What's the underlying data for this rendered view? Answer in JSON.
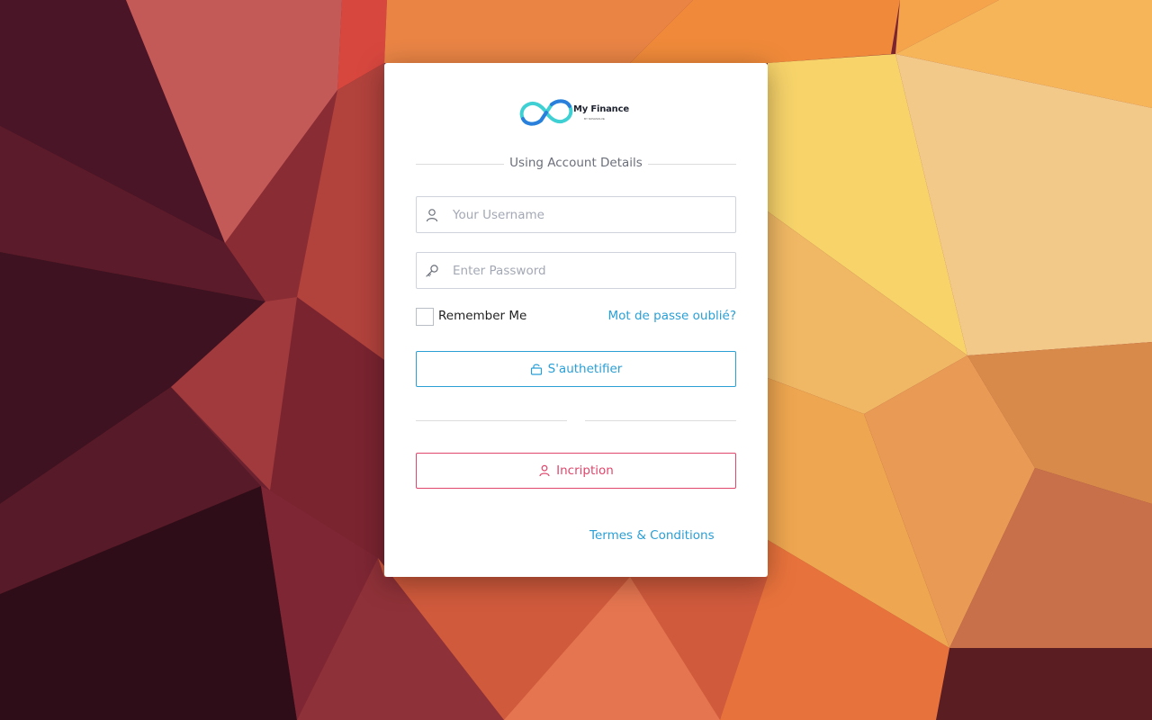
{
  "background": {
    "palette": [
      "#3a0f1e",
      "#7a2430",
      "#b8433a",
      "#e06d3e",
      "#f2a24b",
      "#f7d06a"
    ]
  },
  "brand": {
    "name": "My Finance",
    "tagline": "BY NOVASOLVE",
    "logo_colors": [
      "#3fd0d4",
      "#2a7fdc"
    ]
  },
  "login": {
    "section_label": "Using Account Details",
    "username": {
      "placeholder": "Your Username",
      "value": "",
      "icon": "user-icon"
    },
    "password": {
      "placeholder": "Enter Password",
      "value": "",
      "icon": "key-icon"
    },
    "remember_label": "Remember Me",
    "remember_checked": false,
    "forgot_label": "Mot de passe oublié?",
    "submit_label": "S'authetifier",
    "submit_icon": "lock-icon",
    "signup_label": "Incription",
    "signup_icon": "user-icon",
    "terms_label": "Termes & Conditions"
  },
  "colors": {
    "primary": "#2a9fd6",
    "danger": "#e0466b"
  }
}
